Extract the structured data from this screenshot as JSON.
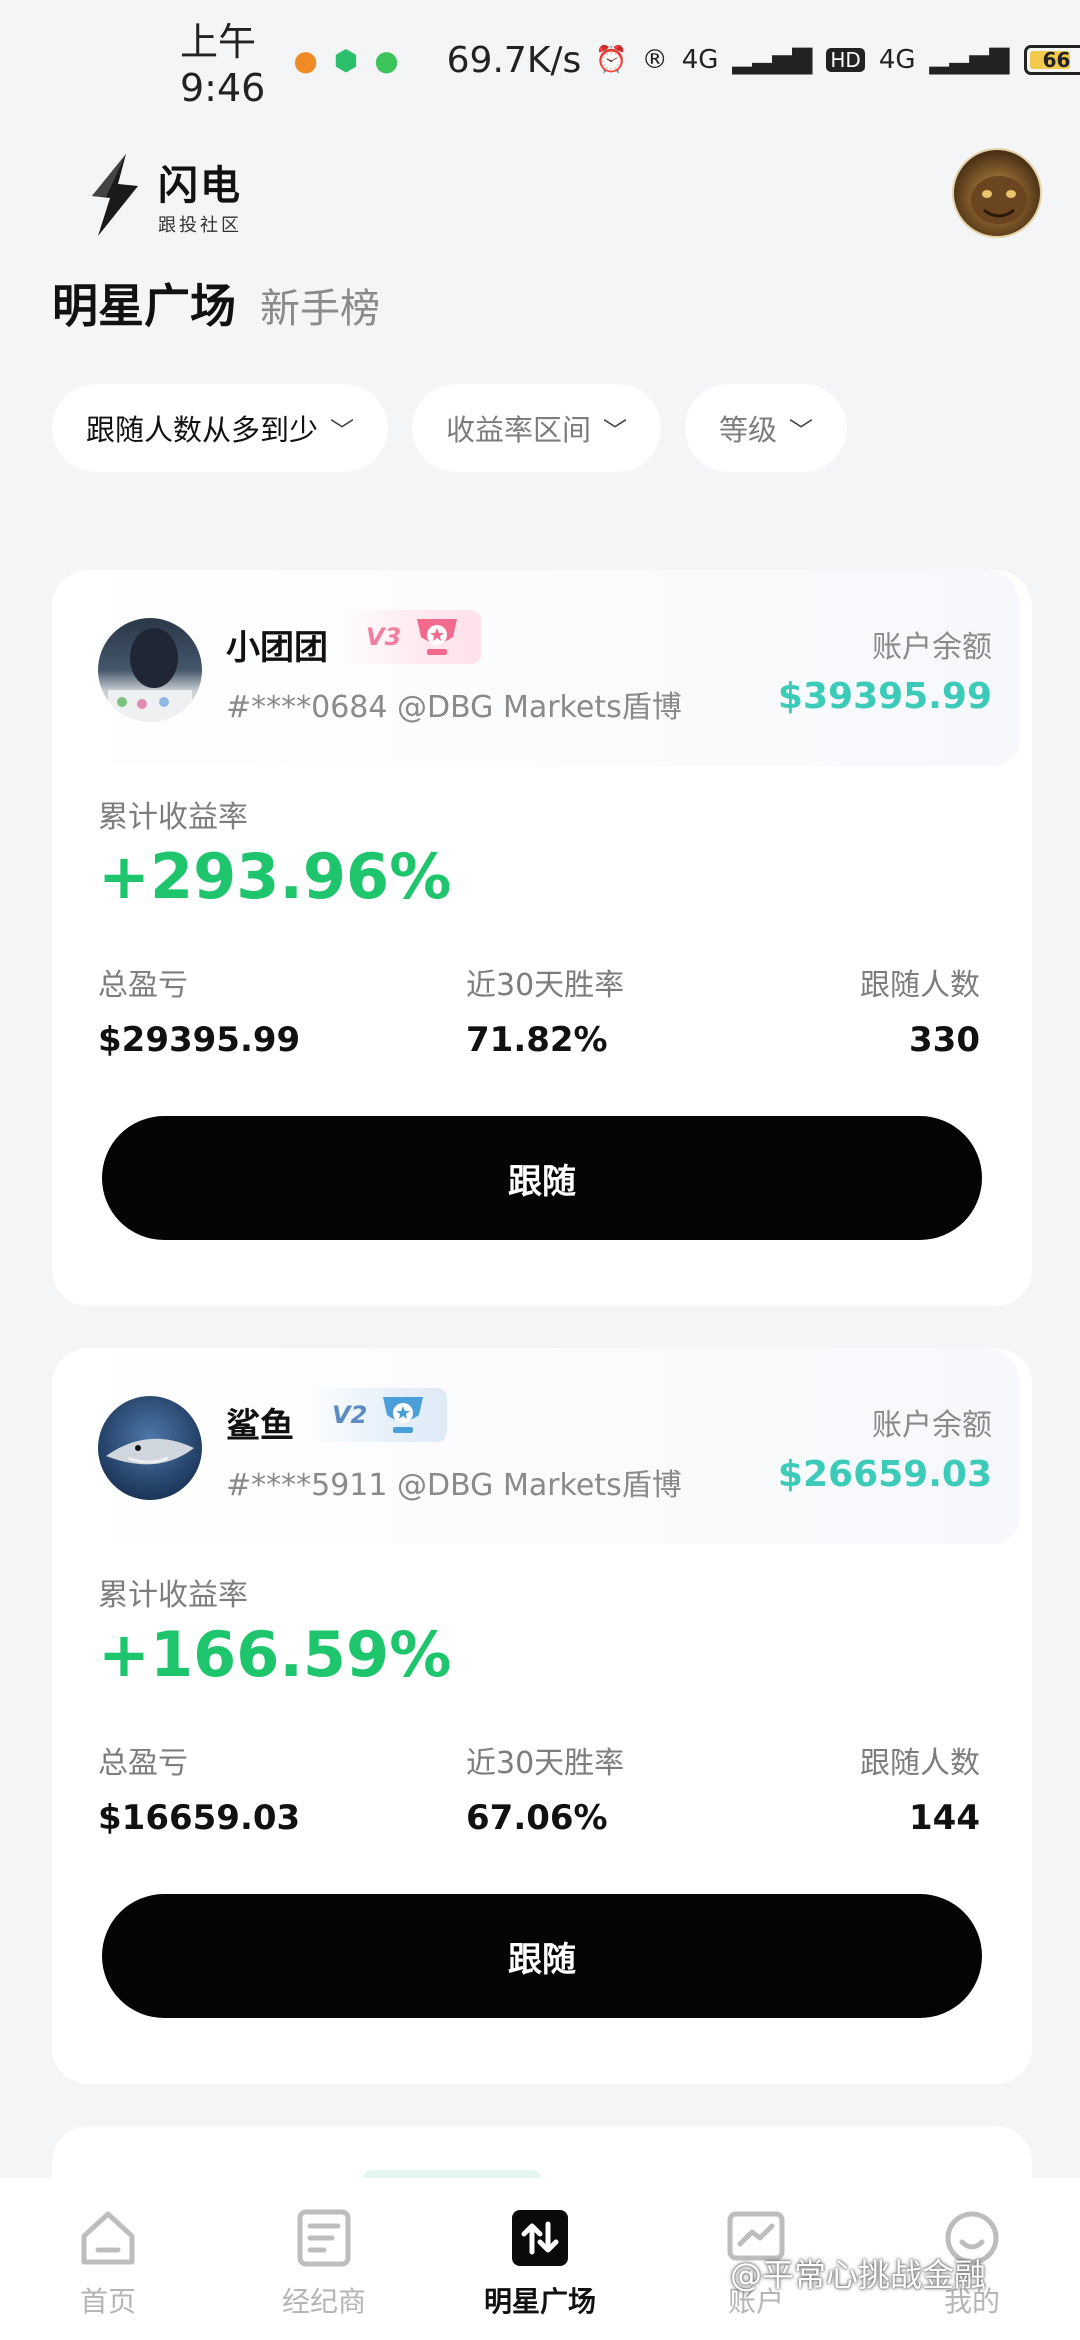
{
  "status_bar": {
    "time": "上午9:46",
    "speed": "69.7K/s",
    "network1": "4G",
    "network2": "4G",
    "hd": "HD",
    "battery": "66"
  },
  "logo": {
    "title": "闪电",
    "subtitle": "跟投社区"
  },
  "tabs": {
    "active": "明星广场",
    "inactive": "新手榜"
  },
  "filters": [
    {
      "label": "跟随人数从多到少"
    },
    {
      "label": "收益率区间"
    },
    {
      "label": "等级"
    }
  ],
  "cards": [
    {
      "name": "小团团",
      "level": "V3",
      "id_line": "#****0684 @DBG Markets盾博",
      "balance_label": "账户余额",
      "balance": "$39395.99",
      "cum_label": "累计收益率",
      "cum_value": "+293.96%",
      "stats": {
        "pnl_label": "总盈亏",
        "pnl": "$29395.99",
        "win_label": "近30天胜率",
        "win": "71.82%",
        "followers_label": "跟随人数",
        "followers": "330"
      },
      "follow_label": "跟随"
    },
    {
      "name": "鲨鱼",
      "level": "V2",
      "id_line": "#****5911 @DBG Markets盾博",
      "balance_label": "账户余额",
      "balance": "$26659.03",
      "cum_label": "累计收益率",
      "cum_value": "+166.59%",
      "stats": {
        "pnl_label": "总盈亏",
        "pnl": "$16659.03",
        "win_label": "近30天胜率",
        "win": "67.06%",
        "followers_label": "跟随人数",
        "followers": "144"
      },
      "follow_label": "跟随"
    }
  ],
  "bottom_nav": [
    {
      "label": "首页",
      "icon": "home-icon"
    },
    {
      "label": "经纪商",
      "icon": "broker-icon"
    },
    {
      "label": "明星广场",
      "icon": "star-square-icon",
      "active": true
    },
    {
      "label": "账户",
      "icon": "account-chart-icon"
    },
    {
      "label": "我的",
      "icon": "profile-icon"
    }
  ],
  "watermark": "@平常心挑战金融"
}
